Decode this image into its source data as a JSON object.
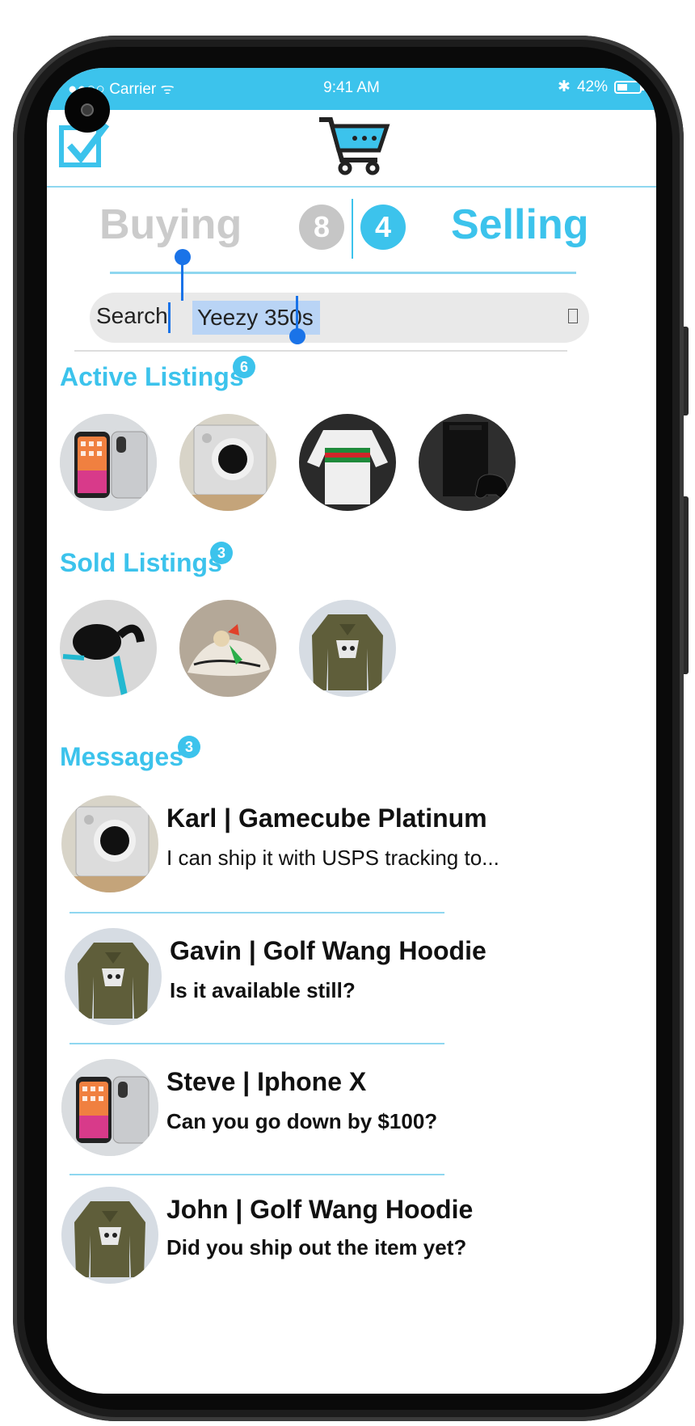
{
  "status_bar": {
    "carrier": "Carrier",
    "time": "9:41 AM",
    "bluetooth": "✱",
    "battery": "42%"
  },
  "header": {
    "left_icon": "checkbox-icon",
    "center_icon": "shopping-cart-icon"
  },
  "tabs": {
    "buying": {
      "label": "Buying",
      "count": "8"
    },
    "selling": {
      "label": "Selling",
      "count": "4"
    }
  },
  "search": {
    "label": "Search",
    "value": "Yeezy 350s",
    "icon": "▯"
  },
  "active_listings": {
    "title": "Active Listings",
    "count": "6",
    "items": [
      "iphone-x",
      "gamecube-platinum",
      "gucci-sweater",
      "xbox-series-x"
    ]
  },
  "sold_listings": {
    "title": "Sold Listings",
    "count": "3",
    "items": [
      "bose-earbuds",
      "yeezy-350s",
      "golf-wang-hoodie"
    ]
  },
  "messages": {
    "title": "Messages",
    "count": "3",
    "items": [
      {
        "name": "Karl | Gamecube Platinum",
        "text": "I can ship it with USPS tracking to..."
      },
      {
        "name": "Gavin | Golf Wang Hoodie",
        "text": "Is it  available still?"
      },
      {
        "name": "Steve | Iphone X",
        "text": "Can you go down by  $100?"
      },
      {
        "name": "John | Golf Wang Hoodie",
        "text": "Did you ship out the item yet?"
      }
    ]
  },
  "colors": {
    "accent": "#3cc3ec",
    "inactive": "#cbcbcb",
    "selection": "#1a73e8"
  }
}
